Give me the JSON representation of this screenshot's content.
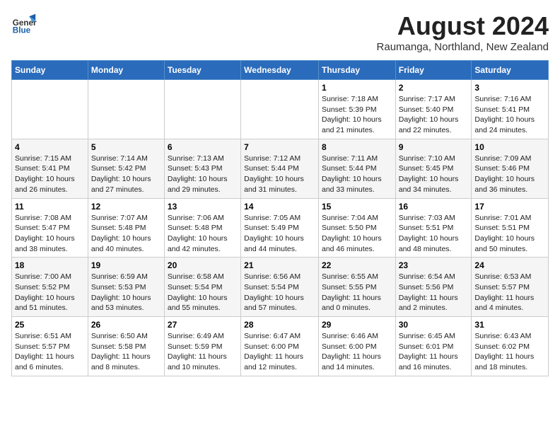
{
  "header": {
    "logo_general": "General",
    "logo_blue": "Blue",
    "month_year": "August 2024",
    "location": "Raumanga, Northland, New Zealand"
  },
  "days_of_week": [
    "Sunday",
    "Monday",
    "Tuesday",
    "Wednesday",
    "Thursday",
    "Friday",
    "Saturday"
  ],
  "weeks": [
    [
      {
        "day": "",
        "info": ""
      },
      {
        "day": "",
        "info": ""
      },
      {
        "day": "",
        "info": ""
      },
      {
        "day": "",
        "info": ""
      },
      {
        "day": "1",
        "info": "Sunrise: 7:18 AM\nSunset: 5:39 PM\nDaylight: 10 hours\nand 21 minutes."
      },
      {
        "day": "2",
        "info": "Sunrise: 7:17 AM\nSunset: 5:40 PM\nDaylight: 10 hours\nand 22 minutes."
      },
      {
        "day": "3",
        "info": "Sunrise: 7:16 AM\nSunset: 5:41 PM\nDaylight: 10 hours\nand 24 minutes."
      }
    ],
    [
      {
        "day": "4",
        "info": "Sunrise: 7:15 AM\nSunset: 5:41 PM\nDaylight: 10 hours\nand 26 minutes."
      },
      {
        "day": "5",
        "info": "Sunrise: 7:14 AM\nSunset: 5:42 PM\nDaylight: 10 hours\nand 27 minutes."
      },
      {
        "day": "6",
        "info": "Sunrise: 7:13 AM\nSunset: 5:43 PM\nDaylight: 10 hours\nand 29 minutes."
      },
      {
        "day": "7",
        "info": "Sunrise: 7:12 AM\nSunset: 5:44 PM\nDaylight: 10 hours\nand 31 minutes."
      },
      {
        "day": "8",
        "info": "Sunrise: 7:11 AM\nSunset: 5:44 PM\nDaylight: 10 hours\nand 33 minutes."
      },
      {
        "day": "9",
        "info": "Sunrise: 7:10 AM\nSunset: 5:45 PM\nDaylight: 10 hours\nand 34 minutes."
      },
      {
        "day": "10",
        "info": "Sunrise: 7:09 AM\nSunset: 5:46 PM\nDaylight: 10 hours\nand 36 minutes."
      }
    ],
    [
      {
        "day": "11",
        "info": "Sunrise: 7:08 AM\nSunset: 5:47 PM\nDaylight: 10 hours\nand 38 minutes."
      },
      {
        "day": "12",
        "info": "Sunrise: 7:07 AM\nSunset: 5:48 PM\nDaylight: 10 hours\nand 40 minutes."
      },
      {
        "day": "13",
        "info": "Sunrise: 7:06 AM\nSunset: 5:48 PM\nDaylight: 10 hours\nand 42 minutes."
      },
      {
        "day": "14",
        "info": "Sunrise: 7:05 AM\nSunset: 5:49 PM\nDaylight: 10 hours\nand 44 minutes."
      },
      {
        "day": "15",
        "info": "Sunrise: 7:04 AM\nSunset: 5:50 PM\nDaylight: 10 hours\nand 46 minutes."
      },
      {
        "day": "16",
        "info": "Sunrise: 7:03 AM\nSunset: 5:51 PM\nDaylight: 10 hours\nand 48 minutes."
      },
      {
        "day": "17",
        "info": "Sunrise: 7:01 AM\nSunset: 5:51 PM\nDaylight: 10 hours\nand 50 minutes."
      }
    ],
    [
      {
        "day": "18",
        "info": "Sunrise: 7:00 AM\nSunset: 5:52 PM\nDaylight: 10 hours\nand 51 minutes."
      },
      {
        "day": "19",
        "info": "Sunrise: 6:59 AM\nSunset: 5:53 PM\nDaylight: 10 hours\nand 53 minutes."
      },
      {
        "day": "20",
        "info": "Sunrise: 6:58 AM\nSunset: 5:54 PM\nDaylight: 10 hours\nand 55 minutes."
      },
      {
        "day": "21",
        "info": "Sunrise: 6:56 AM\nSunset: 5:54 PM\nDaylight: 10 hours\nand 57 minutes."
      },
      {
        "day": "22",
        "info": "Sunrise: 6:55 AM\nSunset: 5:55 PM\nDaylight: 11 hours\nand 0 minutes."
      },
      {
        "day": "23",
        "info": "Sunrise: 6:54 AM\nSunset: 5:56 PM\nDaylight: 11 hours\nand 2 minutes."
      },
      {
        "day": "24",
        "info": "Sunrise: 6:53 AM\nSunset: 5:57 PM\nDaylight: 11 hours\nand 4 minutes."
      }
    ],
    [
      {
        "day": "25",
        "info": "Sunrise: 6:51 AM\nSunset: 5:57 PM\nDaylight: 11 hours\nand 6 minutes."
      },
      {
        "day": "26",
        "info": "Sunrise: 6:50 AM\nSunset: 5:58 PM\nDaylight: 11 hours\nand 8 minutes."
      },
      {
        "day": "27",
        "info": "Sunrise: 6:49 AM\nSunset: 5:59 PM\nDaylight: 11 hours\nand 10 minutes."
      },
      {
        "day": "28",
        "info": "Sunrise: 6:47 AM\nSunset: 6:00 PM\nDaylight: 11 hours\nand 12 minutes."
      },
      {
        "day": "29",
        "info": "Sunrise: 6:46 AM\nSunset: 6:00 PM\nDaylight: 11 hours\nand 14 minutes."
      },
      {
        "day": "30",
        "info": "Sunrise: 6:45 AM\nSunset: 6:01 PM\nDaylight: 11 hours\nand 16 minutes."
      },
      {
        "day": "31",
        "info": "Sunrise: 6:43 AM\nSunset: 6:02 PM\nDaylight: 11 hours\nand 18 minutes."
      }
    ]
  ]
}
